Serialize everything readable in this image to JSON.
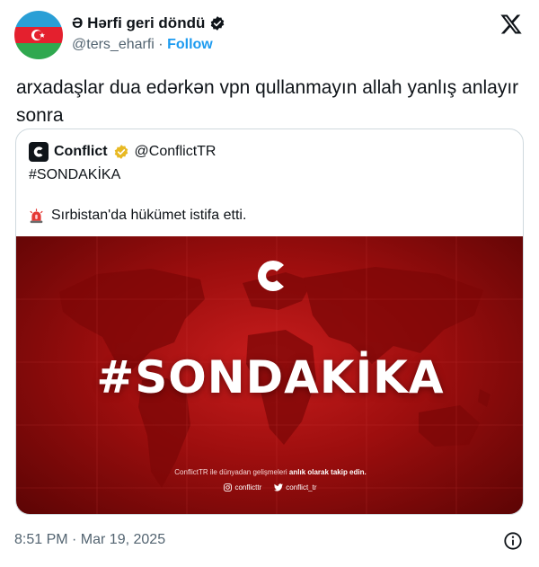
{
  "author": {
    "display_name": "Ə Hərfi geri döndü",
    "handle": "@ters_eharfi",
    "separator": "·",
    "follow_label": "Follow",
    "verified_color": "#0f1419",
    "avatar": "azerbaijan-flag"
  },
  "platform_icon": "x-logo",
  "tweet": {
    "text": "arxadaşlar dua edərkən vpn qullanmayın allah yanlış anlayır sonra"
  },
  "quoted": {
    "account_name": "Conflict",
    "account_handle": "@ConflictTR",
    "verified_color": "#e8b923",
    "line1": "#SONDAKİKA",
    "line2": "Sırbistan'da hükümet istifa etti.",
    "line2_icon": "siren-icon",
    "media": {
      "headline": "#SONDAKİKA",
      "caption_prefix": "ConflictTR ile dünyadan gelişmeleri ",
      "caption_bold": "anlık olarak takip edin.",
      "instagram": "conflicttr",
      "twitter": "conflict_tr",
      "background": "#b01414"
    }
  },
  "footer": {
    "timestamp": "8:51 PM · Mar 19, 2025"
  },
  "colors": {
    "link": "#1d9bf0",
    "muted": "#536471",
    "text": "#0f1419",
    "border": "#cfd9de"
  }
}
